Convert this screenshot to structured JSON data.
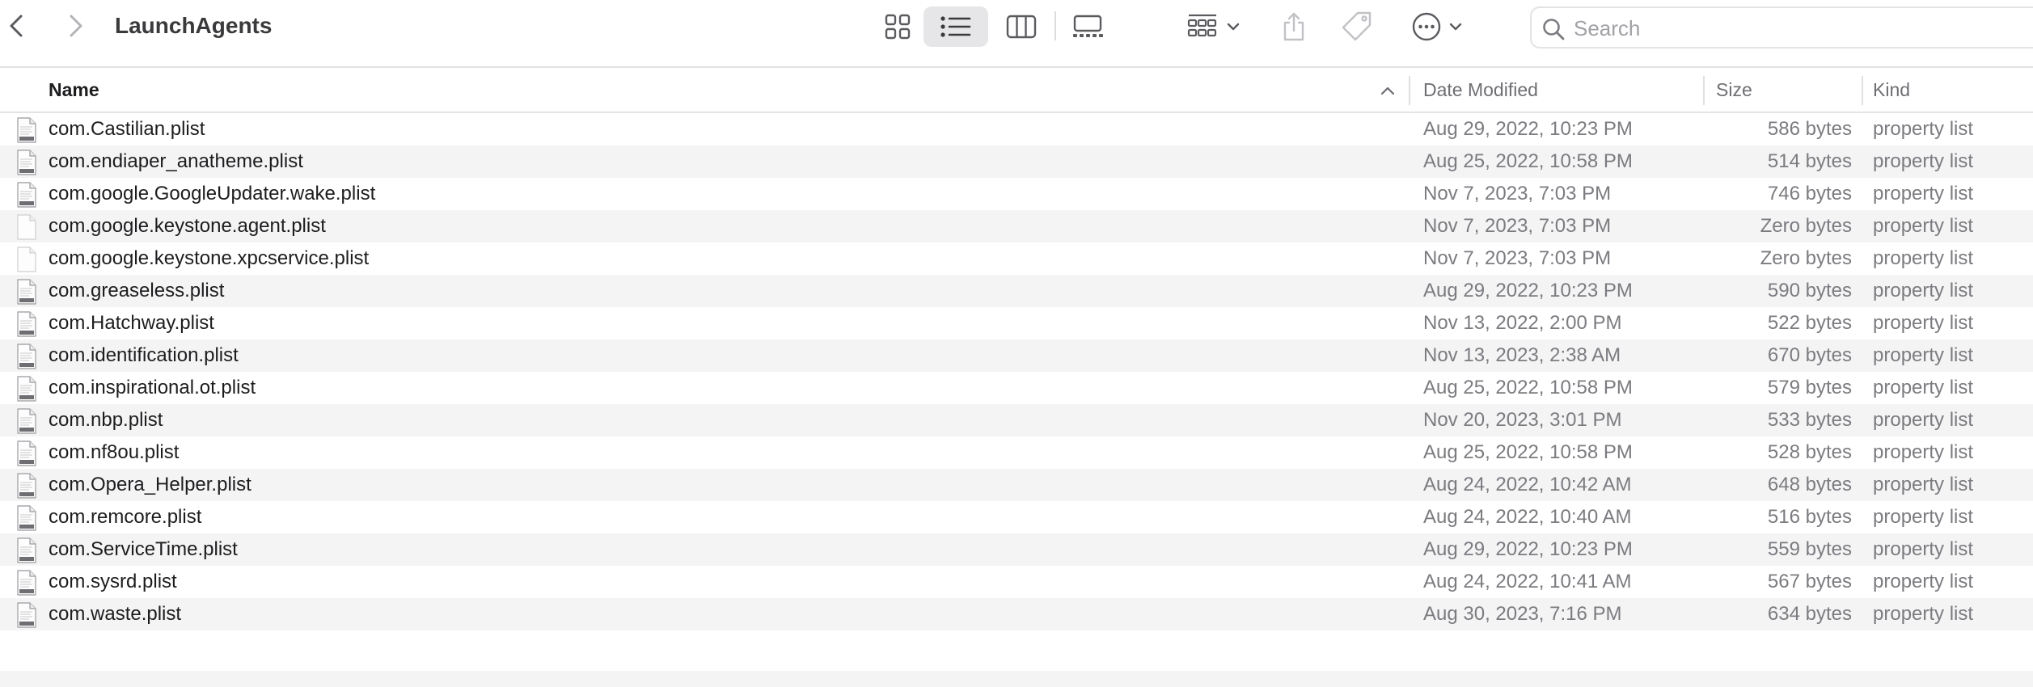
{
  "window": {
    "title": "LaunchAgents"
  },
  "toolbar": {
    "back_icon": "chevron-left-icon",
    "forward_icon": "chevron-right-icon",
    "views": [
      "icon-view",
      "list-view",
      "column-view",
      "gallery-view"
    ],
    "active_view": "list-view",
    "group_icon": "group-icon",
    "share_icon": "share-icon",
    "tag_icon": "tag-icon",
    "more_icon": "more-icon"
  },
  "search": {
    "placeholder": "Search",
    "value": ""
  },
  "columns": {
    "name": "Name",
    "date": "Date Modified",
    "size": "Size",
    "kind": "Kind",
    "sort_column": "name",
    "sort_direction": "ascending"
  },
  "files": [
    {
      "name": "com.Castilian.plist",
      "date": "Aug 29, 2022, 10:23 PM",
      "size": "586 bytes",
      "kind": "property list",
      "icon": "plist"
    },
    {
      "name": "com.endiaper_anatheme.plist",
      "date": "Aug 25, 2022, 10:58 PM",
      "size": "514 bytes",
      "kind": "property list",
      "icon": "plist"
    },
    {
      "name": "com.google.GoogleUpdater.wake.plist",
      "date": "Nov 7, 2023, 7:03 PM",
      "size": "746 bytes",
      "kind": "property list",
      "icon": "plist"
    },
    {
      "name": "com.google.keystone.agent.plist",
      "date": "Nov 7, 2023, 7:03 PM",
      "size": "Zero bytes",
      "kind": "property list",
      "icon": "blank"
    },
    {
      "name": "com.google.keystone.xpcservice.plist",
      "date": "Nov 7, 2023, 7:03 PM",
      "size": "Zero bytes",
      "kind": "property list",
      "icon": "blank"
    },
    {
      "name": "com.greaseless.plist",
      "date": "Aug 29, 2022, 10:23 PM",
      "size": "590 bytes",
      "kind": "property list",
      "icon": "plist"
    },
    {
      "name": "com.Hatchway.plist",
      "date": "Nov 13, 2022, 2:00 PM",
      "size": "522 bytes",
      "kind": "property list",
      "icon": "plist"
    },
    {
      "name": "com.identification.plist",
      "date": "Nov 13, 2023, 2:38 AM",
      "size": "670 bytes",
      "kind": "property list",
      "icon": "plist"
    },
    {
      "name": "com.inspirational.ot.plist",
      "date": "Aug 25, 2022, 10:58 PM",
      "size": "579 bytes",
      "kind": "property list",
      "icon": "plist"
    },
    {
      "name": "com.nbp.plist",
      "date": "Nov 20, 2023, 3:01 PM",
      "size": "533 bytes",
      "kind": "property list",
      "icon": "plist"
    },
    {
      "name": "com.nf8ou.plist",
      "date": "Aug 25, 2022, 10:58 PM",
      "size": "528 bytes",
      "kind": "property list",
      "icon": "plist"
    },
    {
      "name": "com.Opera_Helper.plist",
      "date": "Aug 24, 2022, 10:42 AM",
      "size": "648 bytes",
      "kind": "property list",
      "icon": "plist"
    },
    {
      "name": "com.remcore.plist",
      "date": "Aug 24, 2022, 10:40 AM",
      "size": "516 bytes",
      "kind": "property list",
      "icon": "plist"
    },
    {
      "name": "com.ServiceTime.plist",
      "date": "Aug 29, 2022, 10:23 PM",
      "size": "559 bytes",
      "kind": "property list",
      "icon": "plist"
    },
    {
      "name": "com.sysrd.plist",
      "date": "Aug 24, 2022, 10:41 AM",
      "size": "567 bytes",
      "kind": "property list",
      "icon": "plist"
    },
    {
      "name": "com.waste.plist",
      "date": "Aug 30, 2023, 7:16 PM",
      "size": "634 bytes",
      "kind": "property list",
      "icon": "plist"
    }
  ]
}
